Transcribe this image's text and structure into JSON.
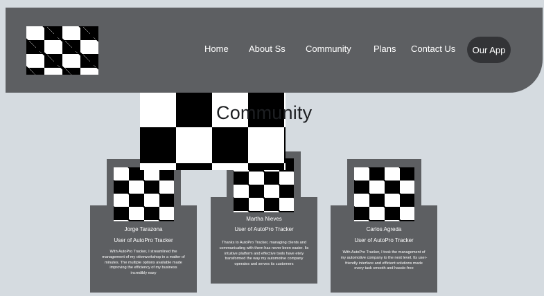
{
  "nav": {
    "links": [
      "Home",
      "About Ss",
      "Community",
      "Plans",
      "Contact Us"
    ],
    "cta": "Our App"
  },
  "hero": {
    "title": "Community"
  },
  "testimonials": [
    {
      "name": "Jorge Tarazona",
      "role": "User of AutoPro Tracker",
      "text": "With AutoPro Tracker, I streamlined the management of my otiveworkshop in a matter of minutes. The multiple options available made improving the efficiency of my business incredibly easy"
    },
    {
      "name": "Martha Nieves",
      "role": "User of AutoPro Tracker",
      "text": "Thanks to AutoPro Tracker, managing clients and communicating with them has never been easier. Its intuitive platform and effective tools have etely transformed the way my automotive company operates and serves its customers"
    },
    {
      "name": "Carlos Agreda",
      "role": "User of AutoPro Tracker",
      "text": "With AutoPro Tracker, I took the management of my automotive company to the next level. Its user-friendly interface and efficient solutions made every task smooth and hassle-free"
    }
  ],
  "colors": {
    "background": "#d5dbe0",
    "header": "#5d5f62",
    "cta": "#333437",
    "text_light": "#ffffff"
  }
}
